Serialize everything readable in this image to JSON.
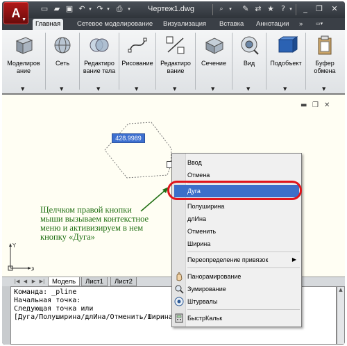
{
  "window": {
    "title": "Чертеж1.dwg",
    "logo_letter": "A"
  },
  "ribbon": {
    "tabs": [
      "Главная",
      "Сетевое моделирование",
      "Визуализация",
      "Вставка",
      "Аннотации"
    ],
    "more_tabs_icon": "double-chevron-right-icon",
    "buttons": [
      {
        "label_lines": [
          "Моделиров",
          "ание"
        ],
        "icon": "box-icon"
      },
      {
        "label_lines": [
          "Сеть"
        ],
        "icon": "mesh-icon"
      },
      {
        "label_lines": [
          "Редактиро",
          "вание тела"
        ],
        "icon": "solid-edit-icon"
      },
      {
        "label_lines": [
          "Рисование"
        ],
        "icon": "draw-icon"
      },
      {
        "label_lines": [
          "Редактиро",
          "вание"
        ],
        "icon": "modify-icon"
      },
      {
        "label_lines": [
          "Сечение"
        ],
        "icon": "section-icon"
      },
      {
        "label_lines": [
          "Вид"
        ],
        "icon": "view-icon"
      },
      {
        "label_lines": [
          "Подобъект"
        ],
        "icon": "subobject-icon"
      },
      {
        "label_lines": [
          "Буфер",
          "обмена"
        ],
        "icon": "clipboard-icon"
      }
    ]
  },
  "drawing": {
    "dimension_value": "428.9989"
  },
  "callout": {
    "lines": [
      "Щелчком правой кнопки",
      "мыши вызываем контекстное",
      "меню и активизируем в нем",
      "кнопку «Дуга»"
    ],
    "color": "#1f6f12"
  },
  "layout_tabs": [
    "Модель",
    "Лист1",
    "Лист2"
  ],
  "command_line": {
    "lines": [
      "Команда: _pline",
      "Начальная точка:",
      "Следующая точка или",
      "[Дуга/Полуширина/длИна/Отменить/Ширина]:"
    ]
  },
  "context_menu": {
    "items": [
      {
        "label": "Ввод"
      },
      {
        "label": "Отмена"
      },
      {
        "label": "Дуга",
        "highlighted": true
      },
      {
        "label": "Полуширина"
      },
      {
        "label": "длИна"
      },
      {
        "label": "Отменить"
      },
      {
        "label": "Ширина"
      },
      {
        "label": "Переопределение привязок",
        "submenu": true
      },
      {
        "label": "Панорамирование",
        "icon": "pan-icon"
      },
      {
        "label": "Зумирование",
        "icon": "zoom-icon"
      },
      {
        "label": "Штурвалы",
        "icon": "steering-wheel-icon"
      },
      {
        "label": "БыстрКальк",
        "icon": "calculator-icon"
      }
    ],
    "highlight_color": "#3c6fc9",
    "ring_color": "#e0141b"
  }
}
